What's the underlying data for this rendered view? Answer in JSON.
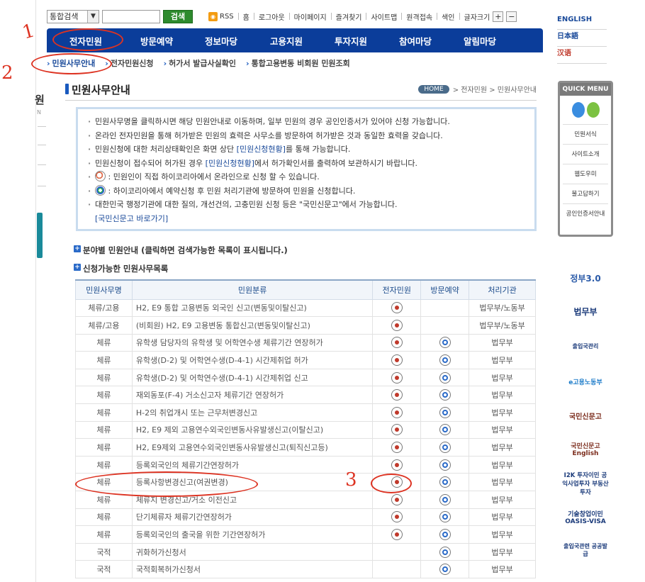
{
  "utility": {
    "search_select": "통합검색",
    "search_button": "검색",
    "links": [
      "RSS",
      "홈",
      "로그아웃",
      "마이페이지",
      "즐겨찾기",
      "사이트맵",
      "원격접속",
      "색인",
      "글자크기"
    ],
    "size_plus": "+",
    "size_minus": "−"
  },
  "languages": [
    "ENGLISH",
    "日本語",
    "汉语"
  ],
  "main_nav": [
    "전자민원",
    "방문예약",
    "정보마당",
    "고용지원",
    "투자지원",
    "참여마당",
    "알림마당"
  ],
  "sub_nav": [
    "민원사무안내",
    "전자민원신청",
    "허가서 발급사실확인",
    "통합고용변동 비회원 민원조회"
  ],
  "page_title": "민원사무안내",
  "breadcrumb": {
    "home": "HOME",
    "path": "> 전자민원 > 민원사무안내"
  },
  "info": {
    "line1": "민원사무명을 클릭하시면 해당 민원안내로 이동하며, 일부 민원의 경우 공인인증서가 있어야 신청 가능합니다.",
    "line2": "온라인 전자민원을 통해 허가받은 민원의 효력은 사무소를 방문하여 허가받은 것과 동일한 효력을 갖습니다.",
    "line3_a": "민원신청에 대한 처리상태확인은 화면 상단 ",
    "line3_link": "[민원신청현황]",
    "line3_b": "를 통해 가능합니다.",
    "line4_a": "민원신청이 접수되어 허가된 경우 ",
    "line4_link": "[민원신청현황]",
    "line4_b": "에서 허가확인서를 출력하여 보관하시기 바랍니다.",
    "line5": " : 민원인이 직접 하이코리아에서 온라인으로 신청 할 수 있습니다.",
    "line6": " : 하이코리아에서 예약신청 후 민원 처리기관에 방문하여 민원을 신청합니다.",
    "line7": "대한민국 행정기관에 대한 질의, 개선건의, 고충민원 신청 등은 \"국민신문고\"에서 가능합니다.",
    "line7_link": "[국민신문고 바로가기]"
  },
  "section1": "분야별 민원안내 (클릭하면 검색가능한 목록이 표시됩니다.)",
  "section2": "신청가능한 민원사무목록",
  "table": {
    "headers": [
      "민원사무명",
      "민원분류",
      "전자민원",
      "방문예약",
      "처리기관"
    ],
    "rows": [
      {
        "cat": "체류/고용",
        "name": "H2, E9 통합 고용변동 외국인 신고(변동및이탈신고)",
        "e": true,
        "v": false,
        "org": "법무부/노동부"
      },
      {
        "cat": "체류/고용",
        "name": "(비회원) H2, E9 고용변동 통합신고(변동및이탈신고)",
        "e": true,
        "v": false,
        "org": "법무부/노동부"
      },
      {
        "cat": "체류",
        "name": "유학생 담당자의 유학생 및 어학연수생 체류기간 연장허가",
        "e": true,
        "v": true,
        "org": "법무부"
      },
      {
        "cat": "체류",
        "name": "유학생(D-2) 및 어학연수생(D-4-1) 시간제취업 허가",
        "e": true,
        "v": true,
        "org": "법무부"
      },
      {
        "cat": "체류",
        "name": "유학생(D-2) 및 어학연수생(D-4-1) 시간제취업 신고",
        "e": true,
        "v": true,
        "org": "법무부"
      },
      {
        "cat": "체류",
        "name": "재외동포(F-4) 거소신고자 체류기간 연장허가",
        "e": true,
        "v": true,
        "org": "법무부"
      },
      {
        "cat": "체류",
        "name": "H-2의 취업개시 또는 근무처변경신고",
        "e": true,
        "v": true,
        "org": "법무부"
      },
      {
        "cat": "체류",
        "name": "H2, E9 제외 고용연수외국인변동사유발생신고(이탈신고)",
        "e": true,
        "v": true,
        "org": "법무부"
      },
      {
        "cat": "체류",
        "name": "H2, E9제외 고용연수외국인변동사유발생신고(퇴직신고등)",
        "e": true,
        "v": true,
        "org": "법무부"
      },
      {
        "cat": "체류",
        "name": "등록외국인의 체류기간연장허가",
        "e": true,
        "v": true,
        "org": "법무부"
      },
      {
        "cat": "체류",
        "name": "등록사항변경신고(여권변경)",
        "e": true,
        "v": true,
        "org": "법무부"
      },
      {
        "cat": "체류",
        "name": "체류지 변경신고/거소 이전신고",
        "e": true,
        "v": true,
        "org": "법무부"
      },
      {
        "cat": "체류",
        "name": "단기체류자 체류기간연장허가",
        "e": true,
        "v": true,
        "org": "법무부"
      },
      {
        "cat": "체류",
        "name": "등록외국인의 출국을 위한 기간연장허가",
        "e": true,
        "v": true,
        "org": "법무부"
      },
      {
        "cat": "국적",
        "name": "귀화허가신청서",
        "e": false,
        "v": true,
        "org": "법무부"
      },
      {
        "cat": "국적",
        "name": "국적회복허가신청서",
        "e": false,
        "v": true,
        "org": "법무부"
      }
    ]
  },
  "quick_menu": {
    "title": "QUICK MENU",
    "items": [
      "민원서식",
      "사이트소개",
      "웹도우미",
      "불고답하기",
      "공인인증서안내"
    ]
  },
  "banners": [
    "정부3.0",
    "법무부",
    "출입국관리",
    "e고용노동부",
    "국민신문고",
    "국민신문고 English",
    "I2K 투자이민 공익사업투자 부동산투자",
    "기술창업이민 OASIS-VISA",
    "출입국관련 공공발급"
  ],
  "left_label": {
    "main": "원",
    "sub": "N"
  },
  "annotations": [
    "1",
    "2",
    "3"
  ],
  "colors": {
    "nav_bg": "#0b3d9a",
    "accent_blue": "#1a5abf",
    "search_green": "#2d8a2d",
    "annotation_red": "#dd3322"
  }
}
